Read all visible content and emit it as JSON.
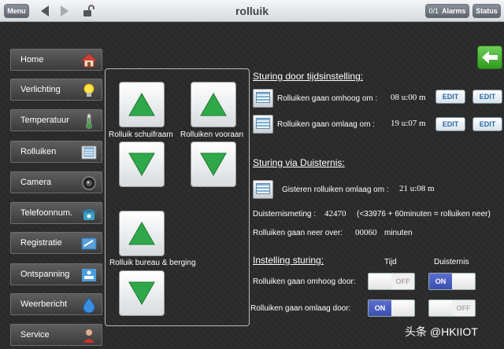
{
  "topbar": {
    "menu_label": "Menu",
    "title": "rolluik",
    "alarms_count": "0/1",
    "alarms_label": "Alarms",
    "status_label": "Status"
  },
  "sidebar": {
    "items": [
      {
        "label": "Home",
        "icon": "house-icon"
      },
      {
        "label": "Verlichting",
        "icon": "lightbulb-icon"
      },
      {
        "label": "Temperatuur",
        "icon": "thermometer-icon"
      },
      {
        "label": "Rolluiken",
        "icon": "shutter-icon"
      },
      {
        "label": "Camera",
        "icon": "camera-icon"
      },
      {
        "label": "Telefoonnum.",
        "icon": "phone-icon"
      },
      {
        "label": "Registratie",
        "icon": "register-icon"
      },
      {
        "label": "Ontspanning",
        "icon": "relax-icon"
      },
      {
        "label": "Weerbericht",
        "icon": "water-drop-icon"
      },
      {
        "label": "Service",
        "icon": "service-icon"
      }
    ]
  },
  "panel": {
    "label_schuifraam": "Rolluik schuifraam",
    "label_vooraan": "Rolluiken vooraan",
    "label_bureau": "Rolluik bureau & berging"
  },
  "tijd": {
    "heading": "Sturing door tijdsinstelling:",
    "omhoog_text": "Rolluiken gaan omhoog om :",
    "omhoog_time": "08 u:00 m",
    "omlaag_text": "Rolluiken gaan omlaag om :",
    "omlaag_time": "19 u:07 m",
    "edit_label": "EDIT"
  },
  "duisternis": {
    "heading": "Sturing via Duisternis:",
    "gisteren_text": "Gisteren rolluiken omlaag om :",
    "gisteren_time": "21 u:08 m",
    "meting_label": "Duisternismeting :",
    "meting_value": "42470",
    "meting_note": "(<33976 + 60minuten = rolluiken neer)",
    "neer_label": "Rolluiken gaan neer over:",
    "neer_value": "00060",
    "neer_unit": "minuten"
  },
  "instelling": {
    "heading": "Instelling sturing:",
    "col_tijd": "Tijd",
    "col_duisternis": "Duisternis",
    "row_omhoog": "Rolluiken gaan omhoog door:",
    "row_omlaag": "Rolluiken gaan omlaag door:",
    "on_label": "ON",
    "off_label": "OFF"
  },
  "watermark": "头条 @HKIIOT",
  "colors": {
    "accent_green": "#2f9a1f",
    "toggle_on": "#3a4fb0",
    "edit_text": "#2a6aa8"
  }
}
